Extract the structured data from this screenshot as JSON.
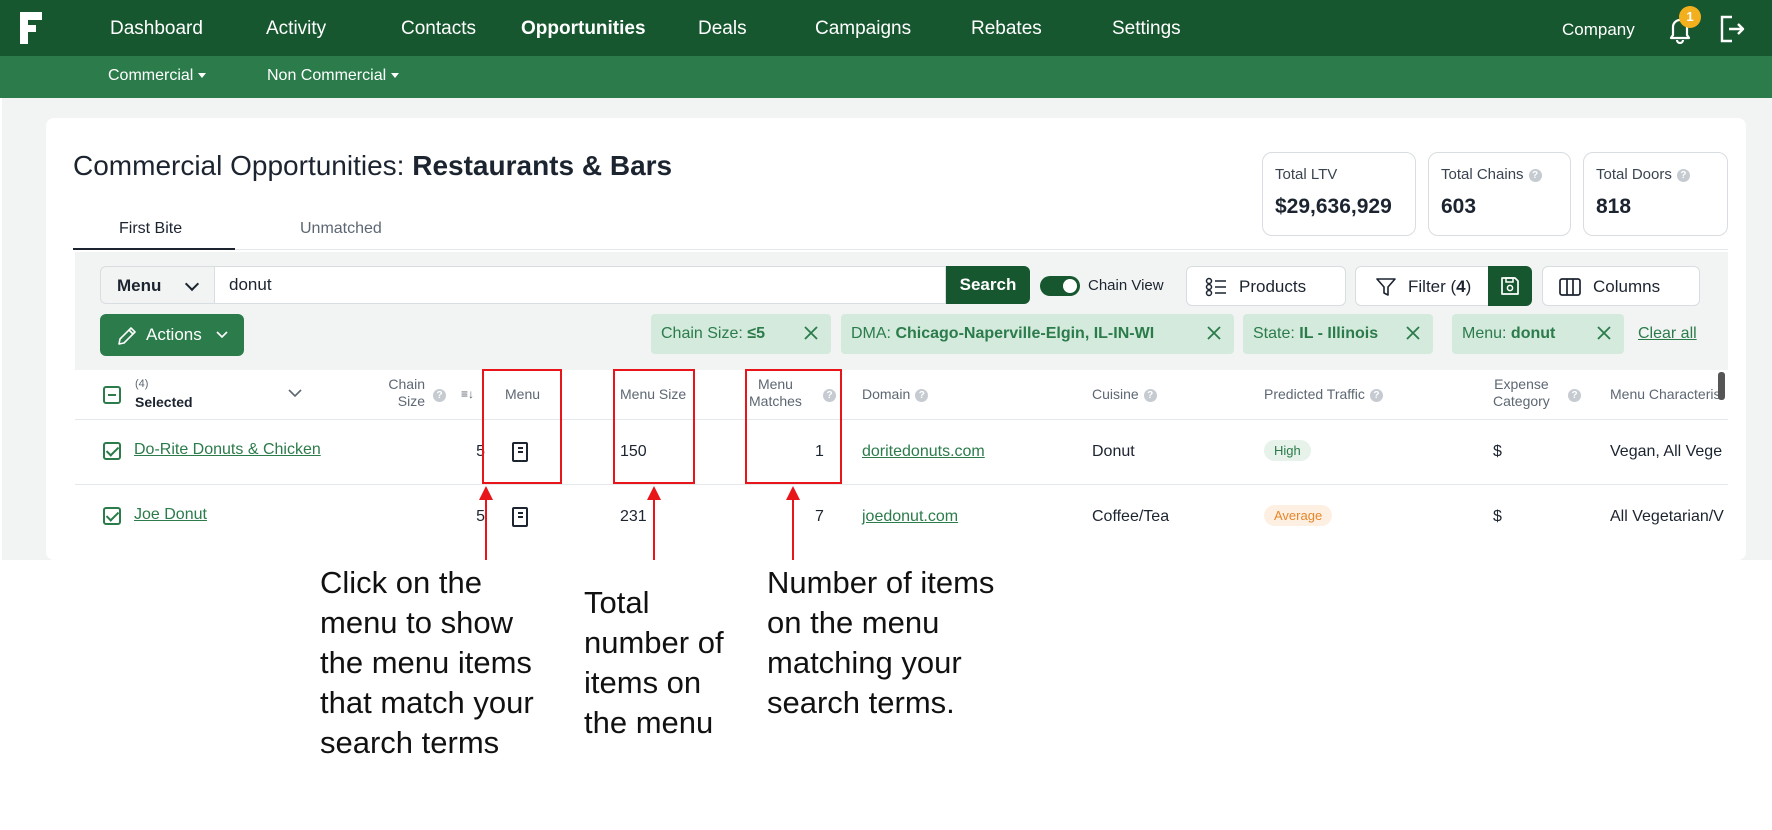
{
  "nav": {
    "items": [
      {
        "label": "Dashboard",
        "active": false
      },
      {
        "label": "Activity",
        "active": false
      },
      {
        "label": "Contacts",
        "active": false
      },
      {
        "label": "Opportunities",
        "active": true
      },
      {
        "label": "Deals",
        "active": false
      },
      {
        "label": "Campaigns",
        "active": false
      },
      {
        "label": "Rebates",
        "active": false
      },
      {
        "label": "Settings",
        "active": false
      }
    ],
    "company": "Company",
    "notification_count": "1",
    "icons": {
      "logo": "f-logo-icon",
      "bell": "bell-icon",
      "logout": "logout-icon"
    }
  },
  "subnav": {
    "items": [
      "Commercial",
      "Non Commercial"
    ]
  },
  "page": {
    "title_prefix": "Commercial Opportunities:",
    "title_bold": "Restaurants & Bars",
    "tabs": [
      "First Bite",
      "Unmatched"
    ],
    "active_tab": "First Bite"
  },
  "stats": [
    {
      "label": "Total LTV",
      "value": "$29,636,929",
      "help": false
    },
    {
      "label": "Total Chains",
      "value": "603",
      "help": true
    },
    {
      "label": "Total Doors",
      "value": "818",
      "help": true
    }
  ],
  "search": {
    "field": "Menu",
    "value": "donut",
    "button": "Search",
    "chain_view_label": "Chain View",
    "chain_view_on": true
  },
  "toolbar": {
    "products": "Products",
    "filter_prefix": "Filter (",
    "filter_count": "4",
    "filter_suffix": ")",
    "columns": "Columns",
    "actions": "Actions"
  },
  "chips": [
    {
      "key": "Chain Size:",
      "value": "≤5"
    },
    {
      "key": "DMA:",
      "value": "Chicago-Naperville-Elgin, IL-IN-WI"
    },
    {
      "key": "State:",
      "value": "IL - Illinois"
    },
    {
      "key": "Menu:",
      "value": "donut"
    }
  ],
  "clear_all": "Clear all",
  "table": {
    "selected_count": "(4)",
    "selected_label": "Selected",
    "headers": {
      "chain_size": [
        "Chain",
        "Size"
      ],
      "menu": "Menu",
      "menu_size": "Menu Size",
      "menu_matches": [
        "Menu",
        "Matches"
      ],
      "domain": "Domain",
      "cuisine": "Cuisine",
      "predicted_traffic": "Predicted Traffic",
      "expense_category": [
        "Expense",
        "Category"
      ],
      "menu_characteristics": "Menu Characteris"
    },
    "rows": [
      {
        "name": "Do-Rite Donuts & Chicken",
        "chain_size": "5",
        "menu_size": "150",
        "menu_matches": "1",
        "domain": "doritedonuts.com",
        "cuisine": "Donut",
        "traffic": "High",
        "expense": "$",
        "characteristics": "Vegan, All Vege"
      },
      {
        "name": "Joe Donut",
        "chain_size": "5",
        "menu_size": "231",
        "menu_matches": "7",
        "domain": "joedonut.com",
        "cuisine": "Coffee/Tea",
        "traffic": "Average",
        "expense": "$",
        "characteristics": "All Vegetarian/V"
      }
    ]
  },
  "annotations": {
    "menu": "Click on the menu to show the menu items that match your search terms",
    "menu_size": "Total number of items on the menu",
    "menu_matches": "Number of items on the menu matching your search terms.",
    "color": "#e8161a"
  },
  "colors": {
    "brand_dark": "#17572f",
    "brand": "#2b7b4b",
    "chip_bg": "#d3eadc"
  }
}
